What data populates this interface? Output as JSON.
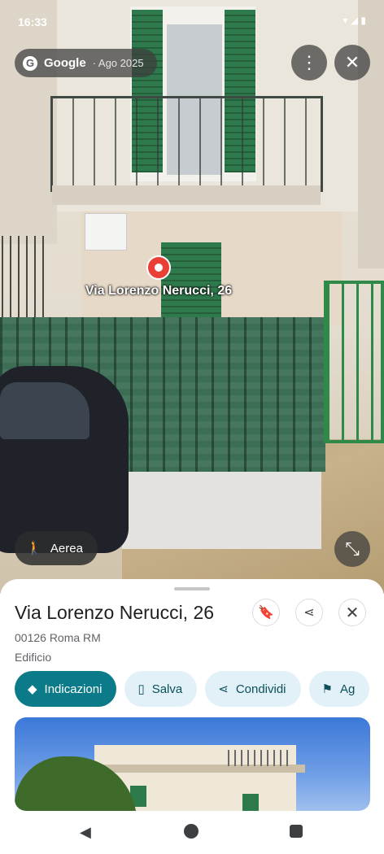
{
  "status": {
    "time": "16:33"
  },
  "imagery": {
    "source": "Google",
    "date": "· Ago 2025"
  },
  "pin": {
    "label": "Via Lorenzo Nerucci, 26"
  },
  "controls": {
    "aerial_label": "Aerea"
  },
  "place": {
    "title": "Via Lorenzo Nerucci, 26",
    "address": "00126 Roma RM",
    "type": "Edificio"
  },
  "actions": [
    {
      "label": "Indicazioni",
      "icon": "directions-icon"
    },
    {
      "label": "Salva",
      "icon": "bookmark-icon"
    },
    {
      "label": "Condividi",
      "icon": "share-icon"
    },
    {
      "label": "Ag",
      "icon": "flag-icon"
    }
  ],
  "colors": {
    "accent": "#0b7b8a",
    "chip_bg": "#e1f1f7",
    "pin": "#ea3f35"
  }
}
